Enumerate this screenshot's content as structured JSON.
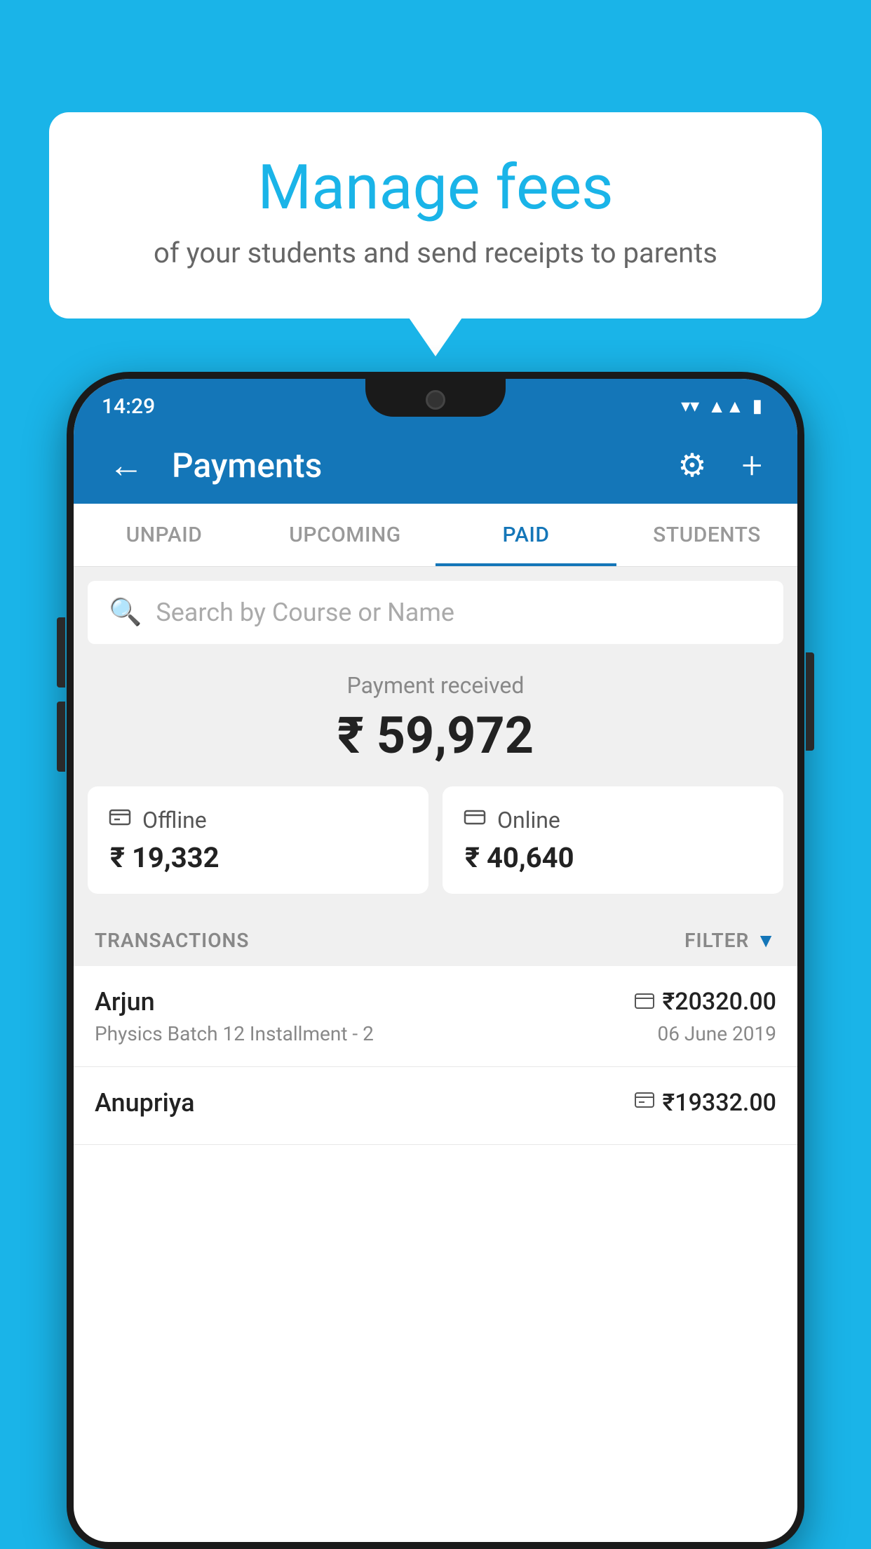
{
  "page": {
    "background_color": "#1ab4e8"
  },
  "speech_bubble": {
    "title": "Manage fees",
    "subtitle": "of your students and send receipts to parents"
  },
  "status_bar": {
    "time": "14:29",
    "wifi_icon": "▾",
    "signal_icon": "▲",
    "battery_icon": "▮"
  },
  "app_bar": {
    "title": "Payments",
    "back_icon": "←",
    "gear_icon": "⚙",
    "add_icon": "+"
  },
  "tabs": [
    {
      "label": "UNPAID",
      "active": false
    },
    {
      "label": "UPCOMING",
      "active": false
    },
    {
      "label": "PAID",
      "active": true
    },
    {
      "label": "STUDENTS",
      "active": false
    }
  ],
  "search": {
    "placeholder": "Search by Course or Name"
  },
  "payment_received": {
    "label": "Payment received",
    "amount": "₹ 59,972"
  },
  "payment_cards": [
    {
      "type": "Offline",
      "amount": "₹ 19,332",
      "icon": "💳"
    },
    {
      "type": "Online",
      "amount": "₹ 40,640",
      "icon": "💳"
    }
  ],
  "transactions_section": {
    "label": "TRANSACTIONS",
    "filter_label": "FILTER"
  },
  "transactions": [
    {
      "name": "Arjun",
      "payment_type_icon": "💳",
      "amount": "₹20320.00",
      "course": "Physics Batch 12 Installment - 2",
      "date": "06 June 2019"
    },
    {
      "name": "Anupriya",
      "payment_type_icon": "💵",
      "amount": "₹19332.00",
      "course": "",
      "date": ""
    }
  ]
}
